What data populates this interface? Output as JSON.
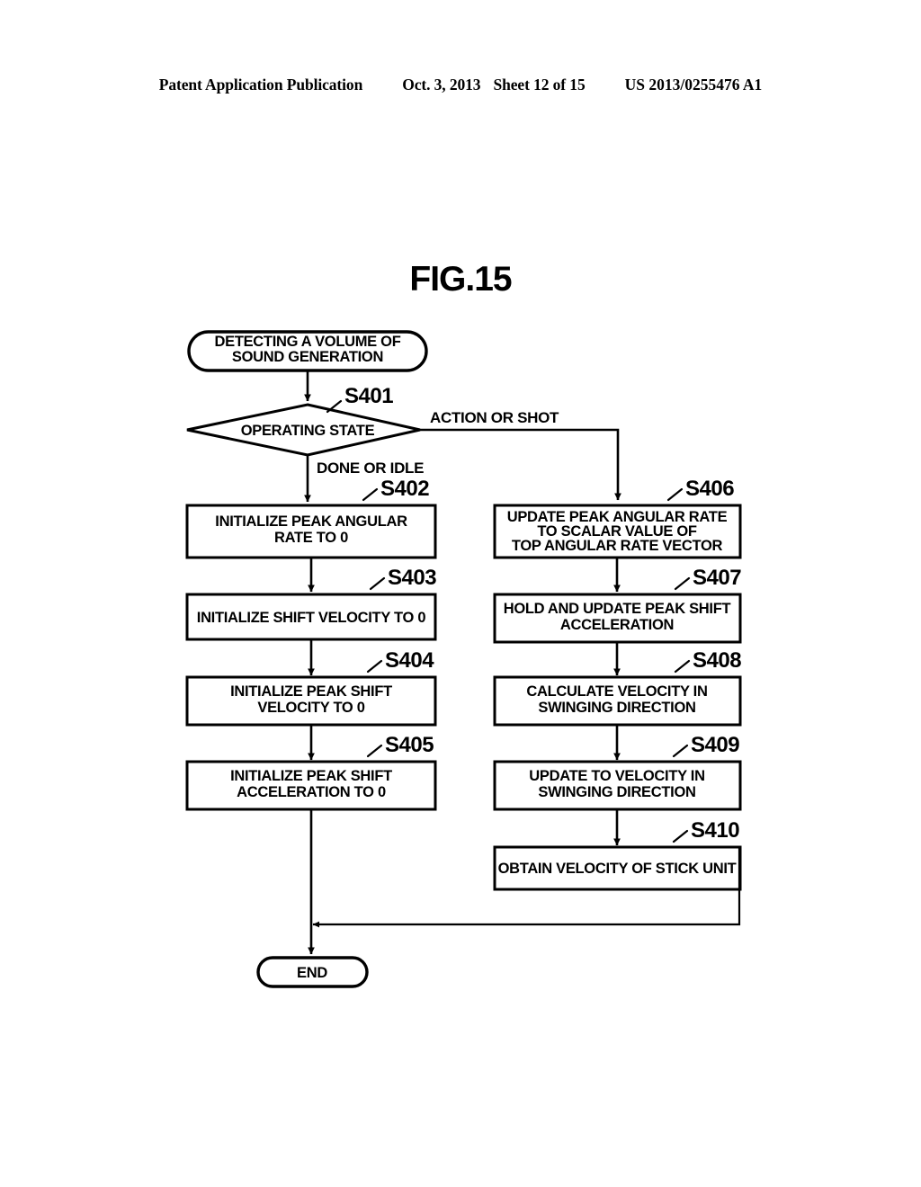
{
  "header": {
    "publication": "Patent Application Publication",
    "date": "Oct. 3, 2013",
    "sheet": "Sheet 12 of 15",
    "patent_number": "US 2013/0255476 A1"
  },
  "figure": {
    "title": "FIG.15"
  },
  "flowchart": {
    "start": {
      "label_line1": "DETECTING A VOLUME OF",
      "label_line2": "SOUND GENERATION"
    },
    "decision": {
      "step": "S401",
      "label": "OPERATING STATE",
      "branch_right": "ACTION OR SHOT",
      "branch_down": "DONE OR IDLE"
    },
    "left_steps": [
      {
        "step": "S402",
        "lines": [
          "INITIALIZE PEAK ANGULAR",
          "RATE TO 0"
        ]
      },
      {
        "step": "S403",
        "lines": [
          "INITIALIZE SHIFT VELOCITY TO 0"
        ]
      },
      {
        "step": "S404",
        "lines": [
          "INITIALIZE PEAK SHIFT",
          "VELOCITY TO 0"
        ]
      },
      {
        "step": "S405",
        "lines": [
          "INITIALIZE PEAK SHIFT",
          "ACCELERATION TO 0"
        ]
      }
    ],
    "right_steps": [
      {
        "step": "S406",
        "lines": [
          "UPDATE PEAK ANGULAR RATE",
          "TO SCALAR VALUE OF",
          "TOP ANGULAR RATE VECTOR"
        ]
      },
      {
        "step": "S407",
        "lines": [
          "HOLD AND UPDATE PEAK SHIFT",
          "ACCELERATION"
        ]
      },
      {
        "step": "S408",
        "lines": [
          "CALCULATE VELOCITY IN",
          "SWINGING DIRECTION"
        ]
      },
      {
        "step": "S409",
        "lines": [
          "UPDATE TO VELOCITY IN",
          "SWINGING DIRECTION"
        ]
      },
      {
        "step": "S410",
        "lines": [
          "OBTAIN VELOCITY OF STICK UNIT"
        ]
      }
    ],
    "end": {
      "label": "END"
    }
  },
  "colors": {
    "ink": "#000000",
    "paper": "#ffffff"
  }
}
